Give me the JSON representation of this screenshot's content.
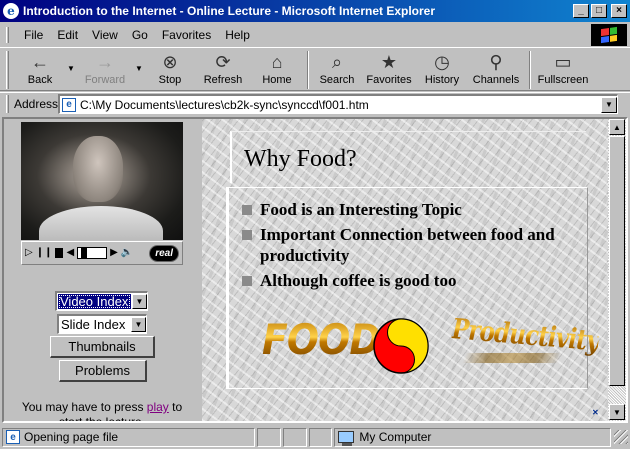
{
  "window": {
    "title": "Introduction to the Internet - Online Lecture - Microsoft Internet Explorer",
    "buttons": {
      "minimize": "_",
      "maximize": "□",
      "close": "×"
    }
  },
  "menu": [
    "File",
    "Edit",
    "View",
    "Go",
    "Favorites",
    "Help"
  ],
  "toolbar": {
    "back": "Back",
    "forward": "Forward",
    "stop": "Stop",
    "refresh": "Refresh",
    "home": "Home",
    "search": "Search",
    "favorites": "Favorites",
    "history": "History",
    "channels": "Channels",
    "fullscreen": "Fullscreen",
    "icons": {
      "back": "←",
      "forward": "→",
      "stop": "⊗",
      "refresh": "⟳",
      "home": "⌂",
      "search": "⌕",
      "favorites": "★",
      "history": "◷",
      "channels": "⚲",
      "fullscreen": "▭"
    }
  },
  "address": {
    "label": "Address",
    "value": "C:\\My Documents\\lectures\\cb2k-sync\\synccd\\f001.htm"
  },
  "left_frame": {
    "player": {
      "brand": "real"
    },
    "video_index": "Video Index",
    "slide_index": "Slide Index",
    "thumbnails_button": "Thumbnails",
    "problems_button": "Problems",
    "note_prefix": "You may have to press ",
    "note_link": "play",
    "note_suffix": " to start the lecture."
  },
  "slide": {
    "title": "Why Food?",
    "bullets": [
      "Food is an Interesting Topic",
      "Important Connection between food and productivity",
      "Although coffee is good too"
    ],
    "word_art_left": "FOOD",
    "word_art_right": "Productivity",
    "colors": {
      "yin": "#ff0000",
      "yang": "#ffe000"
    }
  },
  "status": {
    "message": "Opening page file",
    "zone": "My Computer"
  }
}
